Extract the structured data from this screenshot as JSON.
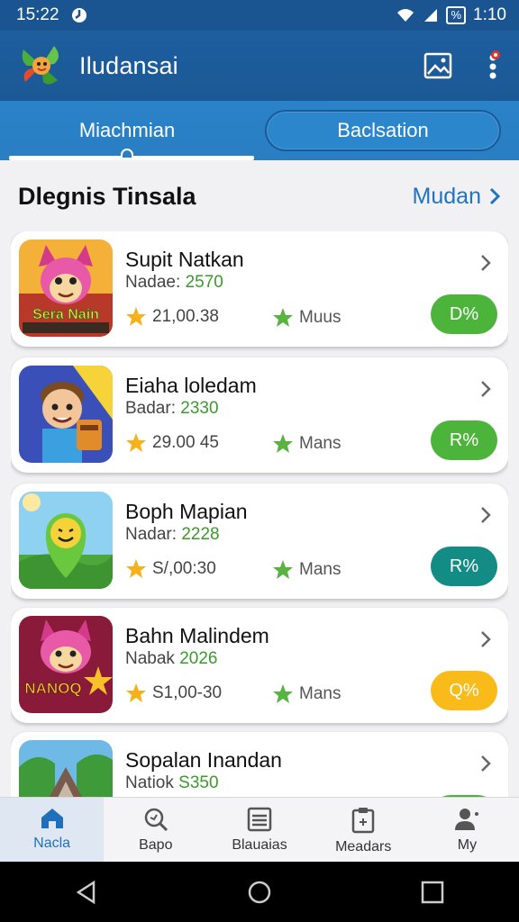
{
  "status_bar": {
    "time": "15:22",
    "battery": "%",
    "clock_right": "1:10"
  },
  "app_bar": {
    "title": "Iludansai"
  },
  "tabs": [
    {
      "label": "Miachmian"
    },
    {
      "label": "Baclsation"
    }
  ],
  "section": {
    "title": "Dlegnis Tinsala",
    "link": "Mudan"
  },
  "cards": [
    {
      "name": "Supit Natkan",
      "sub_label": "Nadae:",
      "sub_value": "2570",
      "rating": "21,00.38",
      "green_label": "Muus",
      "pill": "D%",
      "pill_color": "#4cb43a",
      "thumb_text": "Sera Nain"
    },
    {
      "name": "Eiaha loledam",
      "sub_label": "Badar:",
      "sub_value": "2330",
      "rating": "29.00 45",
      "green_label": "Mans",
      "pill": "R%",
      "pill_color": "#4cb43a"
    },
    {
      "name": "Boph Mapian",
      "sub_label": "Nadar:",
      "sub_value": "2228",
      "rating": "S/,00:30",
      "green_label": "Mans",
      "pill": "R%",
      "pill_color": "#138c86"
    },
    {
      "name": "Bahn Malindem",
      "sub_label": "Nabak",
      "sub_value": "2026",
      "rating": "S1,00-30",
      "green_label": "Mans",
      "pill": "Q%",
      "pill_color": "#f9bb1a",
      "thumb_text": "NANOQ"
    },
    {
      "name": "Sopalan Inandan",
      "sub_label": "Natiok",
      "sub_value": "S350"
    }
  ],
  "bottom_nav": [
    {
      "label": "Nacla",
      "icon": "home-icon"
    },
    {
      "label": "Bapo",
      "icon": "search-icon"
    },
    {
      "label": "Blauaias",
      "icon": "list-icon"
    },
    {
      "label": "Meadars",
      "icon": "clipboard-icon"
    },
    {
      "label": "My",
      "icon": "person-icon"
    }
  ],
  "colors": {
    "app_bar": "#1b5896",
    "tabs": "#2a80c5",
    "accent_green": "#4cb43a",
    "teal": "#138c86",
    "yellow": "#f9bb1a",
    "link_blue": "#1f74c2"
  }
}
